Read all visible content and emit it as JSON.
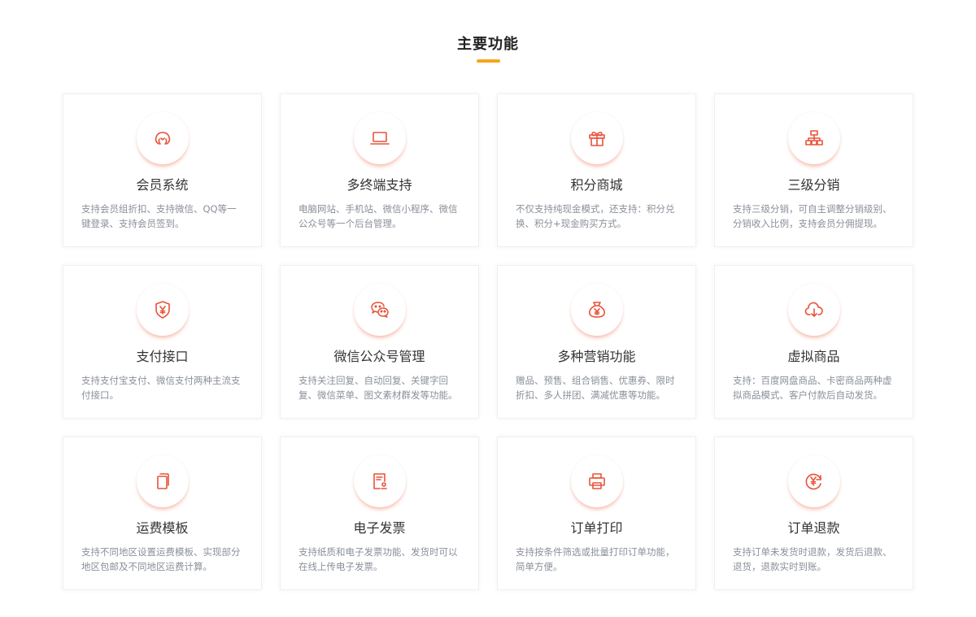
{
  "section": {
    "title": "主要功能",
    "accent_color": "#f7a51c",
    "icon_color": "#e8533a"
  },
  "cards": [
    {
      "icon": "members-icon",
      "title": "会员系统",
      "desc": "支持会员组折扣、支持微信、QQ等一键登录、支持会员签到。"
    },
    {
      "icon": "laptop-icon",
      "title": "多终端支持",
      "desc": "电脑网站、手机站、微信小程序、微信公众号等一个后台管理。"
    },
    {
      "icon": "gift-icon",
      "title": "积分商城",
      "desc": "不仅支持纯现金模式，还支持：积分兑换、积分+现金购买方式。"
    },
    {
      "icon": "hierarchy-icon",
      "title": "三级分销",
      "desc": "支持三级分销，可自主调整分销级别、分销收入比例，支持会员分佣提现。"
    },
    {
      "icon": "shield-yen-icon",
      "title": "支付接口",
      "desc": "支持支付宝支付、微信支付两种主流支付接口。"
    },
    {
      "icon": "wechat-icon",
      "title": "微信公众号管理",
      "desc": "支持关注回复、自动回复、关键字回复、微信菜单、图文素材群发等功能。"
    },
    {
      "icon": "money-bag-icon",
      "title": "多种营销功能",
      "desc": "赠品、预售、组合销售、优惠券、限时折扣、多人拼团、满减优惠等功能。"
    },
    {
      "icon": "cloud-download-icon",
      "title": "虚拟商品",
      "desc": "支持：百度网盘商品、卡密商品两种虚拟商品模式、客户付款后自动发货。"
    },
    {
      "icon": "documents-icon",
      "title": "运费模板",
      "desc": "支持不同地区设置运费模板、实现部分地区包邮及不同地区运费计算。"
    },
    {
      "icon": "invoice-icon",
      "title": "电子发票",
      "desc": "支持纸质和电子发票功能、发货时可以在线上传电子发票。"
    },
    {
      "icon": "printer-icon",
      "title": "订单打印",
      "desc": "支持按条件筛选或批量打印订单功能，简单方便。"
    },
    {
      "icon": "refund-icon",
      "title": "订单退款",
      "desc": "支持订单未发货时退款，发货后退款、退货，退款实时到账。"
    }
  ]
}
